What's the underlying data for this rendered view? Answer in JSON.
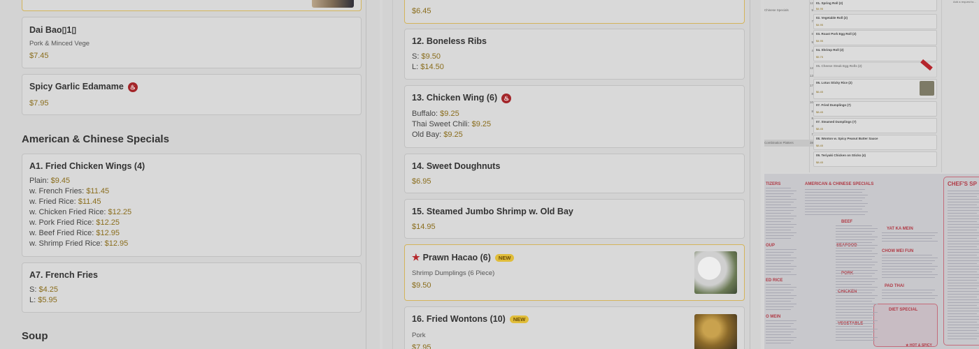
{
  "panel1": {
    "items": [
      {
        "title": "Dai Bao▯1▯",
        "desc": "Pork & Minced Vege",
        "price": "$7.45"
      },
      {
        "title": "Spicy Garlic Edamame",
        "desc": "",
        "price": "$7.95"
      }
    ],
    "section": "American & Chinese Specials",
    "specials": [
      {
        "title": "A1. Fried Chicken Wings (4)",
        "prices": [
          {
            "label": "Plain:",
            "value": "$9.45"
          },
          {
            "label": "w. French Fries:",
            "value": "$11.45"
          },
          {
            "label": "w. Fried Rice:",
            "value": "$11.45"
          },
          {
            "label": "w. Chicken Fried Rice:",
            "value": "$12.25"
          },
          {
            "label": "w. Pork Fried Rice:",
            "value": "$12.25"
          },
          {
            "label": "w. Beef Fried Rice:",
            "value": "$12.95"
          },
          {
            "label": "w. Shrimp Fried Rice:",
            "value": "$12.95"
          }
        ]
      },
      {
        "title": "A7. French Fries",
        "prices": [
          {
            "label": "S:",
            "value": "$4.25"
          },
          {
            "label": "L:",
            "value": "$5.95"
          }
        ]
      }
    ],
    "section2": "Soup"
  },
  "panel2": {
    "top_price": "$6.45",
    "items": [
      {
        "title": "12. Boneless Ribs",
        "prices": [
          {
            "label": "S:",
            "value": "$9.50"
          },
          {
            "label": "L:",
            "value": "$14.50"
          }
        ]
      },
      {
        "title": "13. Chicken Wing (6)",
        "prices": [
          {
            "label": "Buffalo:",
            "value": "$9.25"
          },
          {
            "label": "Thai Sweet Chili:",
            "value": "$9.25"
          },
          {
            "label": "Old Bay:",
            "value": "$9.25"
          }
        ]
      },
      {
        "title": "14. Sweet Doughnuts",
        "price": "$6.95"
      },
      {
        "title": "15. Steamed Jumbo Shrimp w. Old Bay",
        "price": "$14.95"
      },
      {
        "title": "Prawn Hacao (6)",
        "badge": "NEW",
        "desc": "Shrimp Dumplings (6 Piece)",
        "price": "$9.50"
      },
      {
        "title": "16. Fried Wontons (10)",
        "badge": "NEW",
        "desc": "Pork",
        "price": "$7.95"
      }
    ]
  },
  "panel3": {
    "items": [
      {
        "title": "01. Spring Roll (2)",
        "price": "$4.95"
      },
      {
        "title": "02. Vegetable Roll (2)",
        "price": "$4.95"
      },
      {
        "title": "03. Roast Pork Egg Roll (2)",
        "price": "$4.95"
      },
      {
        "title": "04. Shrimp Roll (2)",
        "price": "$5.75"
      },
      {
        "title": "05. Cheese Steak Egg Rolls (2)",
        "price": ""
      },
      {
        "title": "06. Lotus Sticky Rice (2)",
        "price": "$6.45"
      },
      {
        "title": "07. Fried Dumplings (7)",
        "price": "$8.45"
      },
      {
        "title": "07. Steamed Dumplings (7)",
        "price": "$8.45"
      },
      {
        "title": "08. Wonton w. Spicy Peanut Butter Sauce",
        "price": "$8.45"
      },
      {
        "title": "09. Teriyaki Chicken on Sticks (4)",
        "price": "$8.45"
      }
    ],
    "categories": [
      "Chinese Specials"
    ],
    "nums": [
      "12",
      "5",
      "7",
      "8",
      "9",
      "4",
      "12",
      "13",
      "17",
      "8",
      "10",
      "8",
      "8",
      "4",
      "7",
      "9",
      "4",
      "10",
      "3"
    ],
    "last_cat": "Combination Platters",
    "last_num": "38",
    "note": "Add a request to..."
  },
  "panel4": {
    "titles": [
      "AMERICAN & CHINESE SPECIALS",
      "CHEF'S SP",
      "TIZERS",
      "BEEF",
      "YAT KA MEIN",
      "SEAFOOD",
      "CHOW MEI FUN",
      "PORK",
      "PAD THAI",
      "CHICKEN",
      "DIET SPECIAL",
      "VEGETABLE",
      "OUP",
      "ED RICE",
      "O MEIN"
    ],
    "hot_spicy": "★ HOT & SPICY"
  }
}
